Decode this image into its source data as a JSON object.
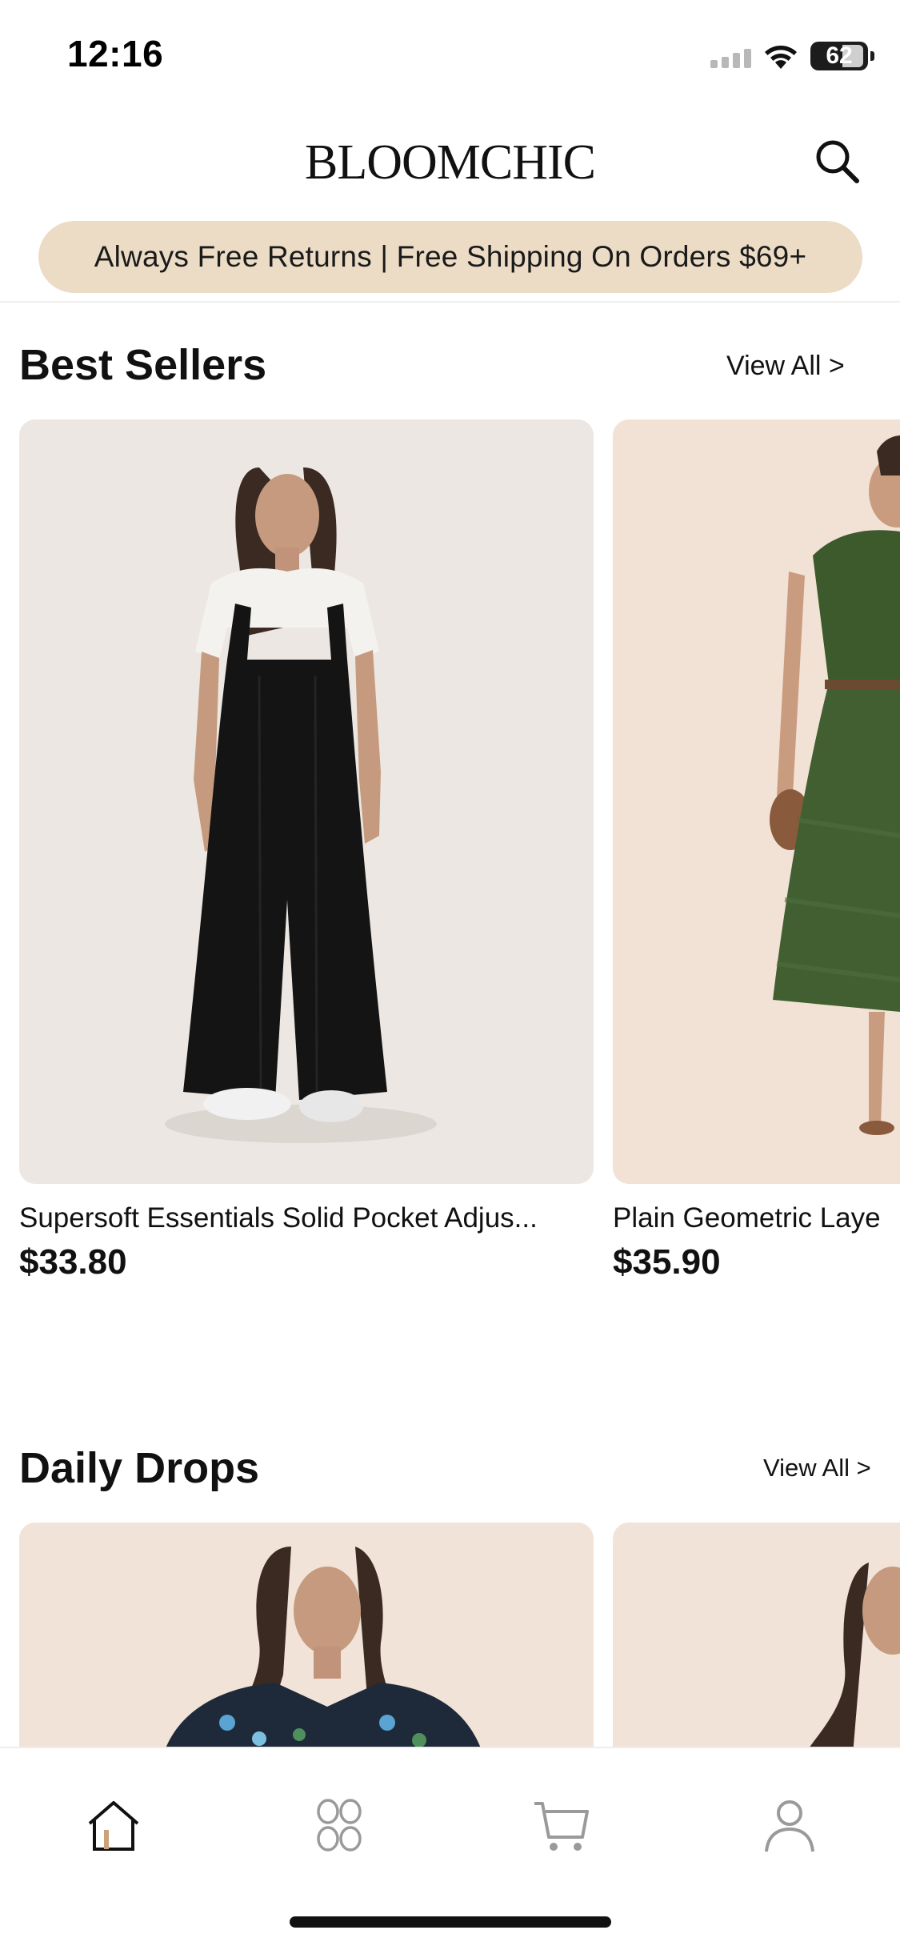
{
  "status_bar": {
    "time": "12:16",
    "battery": "62",
    "icons": [
      "signal-icon",
      "wifi-icon",
      "battery-icon"
    ]
  },
  "header": {
    "logo": "BLOOMCHIC",
    "search_icon": "search-icon"
  },
  "promo": {
    "text": "Always Free Returns | Free Shipping On Orders $69+",
    "color": "#ecdcc6"
  },
  "best_sellers": {
    "title": "Best Sellers",
    "view_all": "View All  >",
    "products": [
      {
        "name": "Supersoft Essentials Solid Pocket Adjus...",
        "price": "$33.80",
        "image": "woman in black wide-leg overalls"
      },
      {
        "name": "Plain Geometric Laye",
        "price": "$35.90",
        "image": "woman in green midi dress"
      }
    ]
  },
  "daily_drops": {
    "title": "Daily Drops",
    "view_all": "View All  >",
    "products": [
      {
        "image": "woman in floral blouse"
      },
      {
        "image": "woman portrait"
      }
    ]
  },
  "tabbar": {
    "tabs": [
      {
        "icon": "home-icon",
        "active": true
      },
      {
        "icon": "categories-icon",
        "active": false
      },
      {
        "icon": "cart-icon",
        "active": false
      },
      {
        "icon": "account-icon",
        "active": false
      }
    ]
  }
}
